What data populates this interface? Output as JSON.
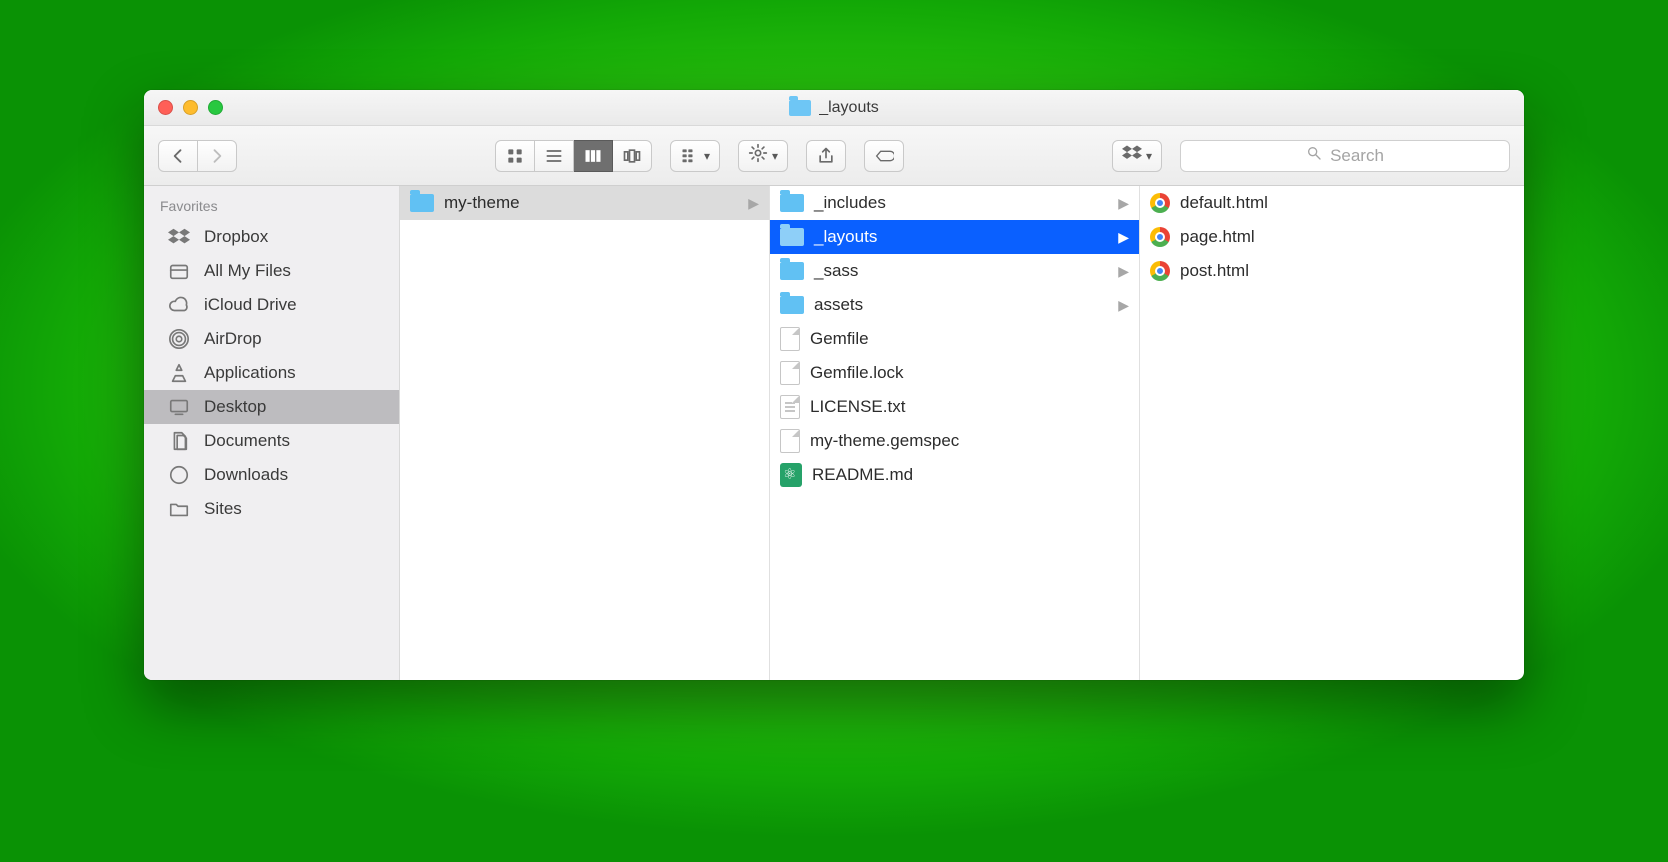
{
  "window_title": "_layouts",
  "search_placeholder": "Search",
  "sidebar_header": "Favorites",
  "sidebar": {
    "items": [
      {
        "label": "Dropbox",
        "icon": "dropbox",
        "selected": false
      },
      {
        "label": "All My Files",
        "icon": "allfiles",
        "selected": false
      },
      {
        "label": "iCloud Drive",
        "icon": "cloud",
        "selected": false
      },
      {
        "label": "AirDrop",
        "icon": "airdrop",
        "selected": false
      },
      {
        "label": "Applications",
        "icon": "apps",
        "selected": false
      },
      {
        "label": "Desktop",
        "icon": "desktop",
        "selected": true
      },
      {
        "label": "Documents",
        "icon": "documents",
        "selected": false
      },
      {
        "label": "Downloads",
        "icon": "downloads",
        "selected": false
      },
      {
        "label": "Sites",
        "icon": "folder",
        "selected": false
      }
    ]
  },
  "columns": [
    {
      "items": [
        {
          "label": "my-theme",
          "kind": "folder",
          "has_children": true,
          "sel": "grey"
        }
      ]
    },
    {
      "items": [
        {
          "label": "_includes",
          "kind": "folder",
          "has_children": true,
          "sel": ""
        },
        {
          "label": "_layouts",
          "kind": "folder",
          "has_children": true,
          "sel": "blue"
        },
        {
          "label": "_sass",
          "kind": "folder",
          "has_children": true,
          "sel": ""
        },
        {
          "label": "assets",
          "kind": "folder",
          "has_children": true,
          "sel": ""
        },
        {
          "label": "Gemfile",
          "kind": "file",
          "has_children": false,
          "sel": ""
        },
        {
          "label": "Gemfile.lock",
          "kind": "file",
          "has_children": false,
          "sel": ""
        },
        {
          "label": "LICENSE.txt",
          "kind": "text",
          "has_children": false,
          "sel": ""
        },
        {
          "label": "my-theme.gemspec",
          "kind": "file",
          "has_children": false,
          "sel": ""
        },
        {
          "label": "README.md",
          "kind": "atom",
          "has_children": false,
          "sel": ""
        }
      ]
    },
    {
      "items": [
        {
          "label": "default.html",
          "kind": "chrome",
          "has_children": false,
          "sel": ""
        },
        {
          "label": "page.html",
          "kind": "chrome",
          "has_children": false,
          "sel": ""
        },
        {
          "label": "post.html",
          "kind": "chrome",
          "has_children": false,
          "sel": ""
        }
      ]
    }
  ]
}
